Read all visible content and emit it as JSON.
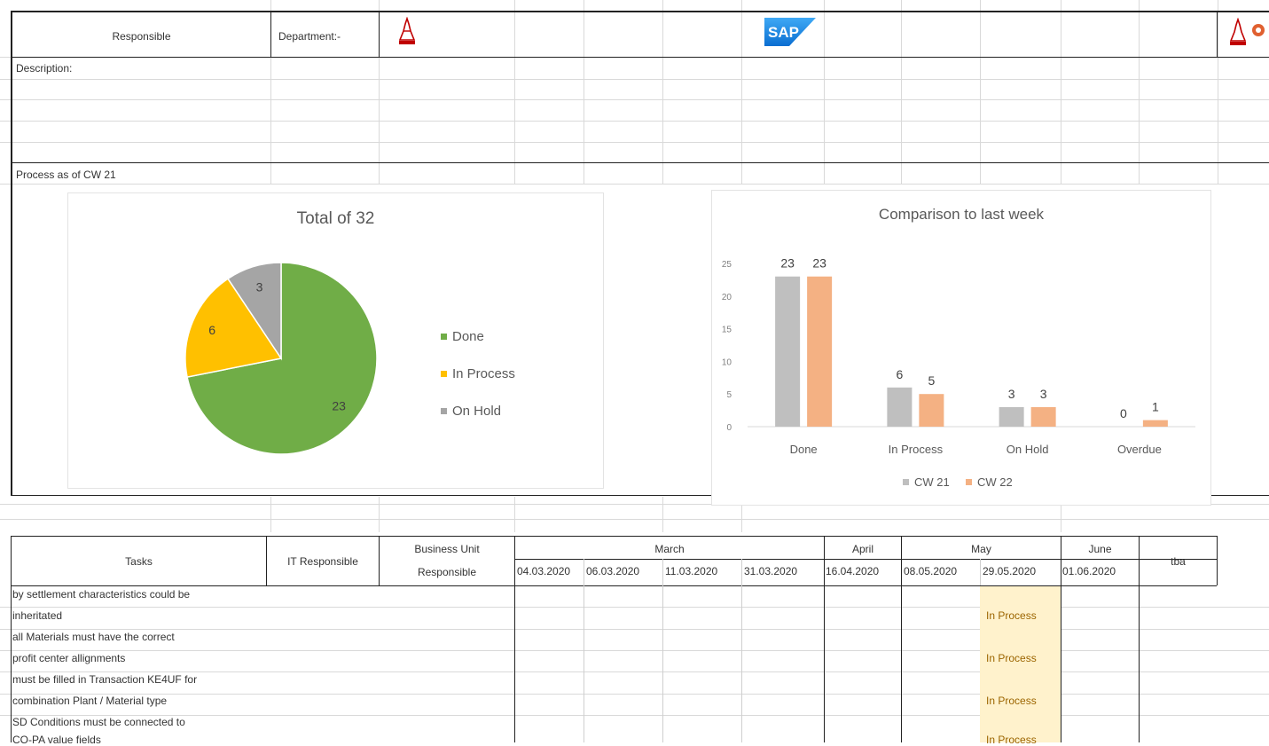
{
  "header": {
    "responsible": "Responsible",
    "department": "Department:-",
    "sap_logo": "SAP",
    "description": "Description:"
  },
  "progress": {
    "label": "Process as of CW 21"
  },
  "colors": {
    "done": "#70ad47",
    "in_process": "#ffc000",
    "on_hold": "#a5a5a5",
    "cw21": "#bfbfbf",
    "cw22": "#f4b183",
    "in_process_cell": "#fff2cc"
  },
  "chart_data": [
    {
      "type": "pie",
      "title": "Total of 32",
      "categories": [
        "Done",
        "In Process",
        "On Hold"
      ],
      "values": [
        23,
        6,
        3
      ],
      "legend": "right"
    },
    {
      "type": "bar",
      "title": "Comparison to last week",
      "categories": [
        "Done",
        "In Process",
        "On Hold",
        "Overdue"
      ],
      "series": [
        {
          "name": "CW 21",
          "values": [
            23,
            6,
            3,
            0
          ]
        },
        {
          "name": "CW 22",
          "values": [
            23,
            5,
            3,
            1
          ]
        }
      ],
      "ylim": [
        0,
        25
      ],
      "yticks": [
        "0",
        "5",
        "10",
        "15",
        "20",
        "25"
      ],
      "legend": "bottom"
    }
  ],
  "table": {
    "headers": {
      "tasks": "Tasks",
      "it_responsible": "IT Responsible",
      "business_unit": "Business Unit",
      "business_unit_2": "Responsible",
      "march": "March",
      "april": "April",
      "may": "May",
      "june": "June",
      "tba": "tba"
    },
    "dates": [
      "04.03.2020",
      "06.03.2020",
      "11.03.2020",
      "31.03.2020",
      "16.04.2020",
      "08.05.2020",
      "29.05.2020",
      "01.06.2020"
    ],
    "rows": [
      {
        "line1": "by settlement characteristics could be",
        "line2": "inheritated",
        "status": "In Process"
      },
      {
        "line1": "all Materials must have the correct",
        "line2": "profit center allignments",
        "status": "In Process"
      },
      {
        "line1": "must be filled in Transaction KE4UF for",
        "line2": "combination Plant / Material type",
        "status": "In Process"
      },
      {
        "line1": "SD Conditions must be connected to",
        "line2": "CO-PA value fields",
        "status": "In Process"
      }
    ]
  }
}
